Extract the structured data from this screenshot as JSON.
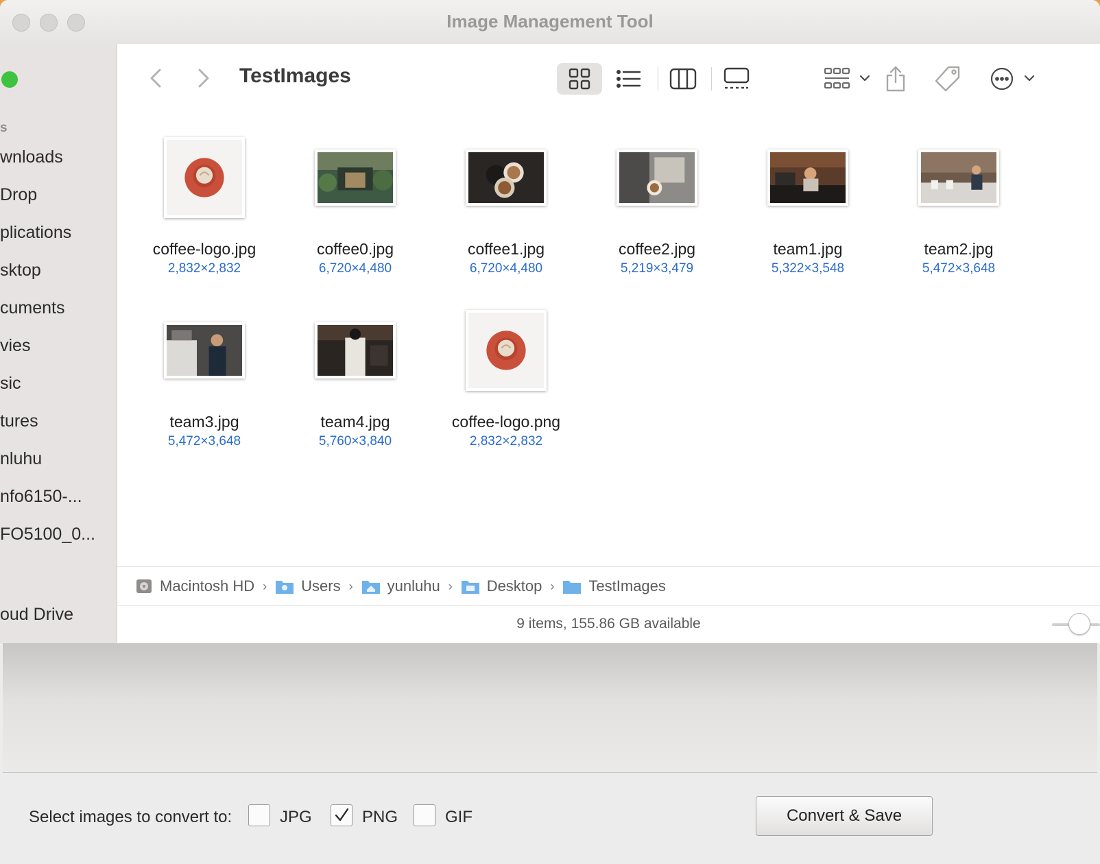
{
  "window": {
    "title": "Image Management Tool"
  },
  "sidebar": {
    "header": "s",
    "items": [
      "wnloads",
      "Drop",
      "plications",
      "sktop",
      "cuments",
      "vies",
      "sic",
      "tures",
      "nluhu",
      "nfo6150-...",
      "FO5100_0...",
      "oud Drive"
    ]
  },
  "toolbar": {
    "folder_title": "TestImages",
    "icons": [
      "back-icon",
      "forward-icon",
      "icon-view-icon",
      "list-view-icon",
      "column-view-icon",
      "gallery-view-icon",
      "group-icon",
      "share-icon",
      "tag-icon",
      "more-icon"
    ]
  },
  "files": [
    {
      "name": "coffee-logo.jpg",
      "dims": "2,832×2,832",
      "kind": "logo"
    },
    {
      "name": "coffee0.jpg",
      "dims": "6,720×4,480",
      "kind": "photo-green"
    },
    {
      "name": "coffee1.jpg",
      "dims": "6,720×4,480",
      "kind": "photo-dark"
    },
    {
      "name": "coffee2.jpg",
      "dims": "5,219×3,479",
      "kind": "photo-grey"
    },
    {
      "name": "team1.jpg",
      "dims": "5,322×3,548",
      "kind": "photo-warm"
    },
    {
      "name": "team2.jpg",
      "dims": "5,472×3,648",
      "kind": "photo-warm2"
    },
    {
      "name": "team3.jpg",
      "dims": "5,472×3,648",
      "kind": "photo-blue"
    },
    {
      "name": "team4.jpg",
      "dims": "5,760×3,840",
      "kind": "photo-dark2"
    },
    {
      "name": "coffee-logo.png",
      "dims": "2,832×2,832",
      "kind": "logo"
    }
  ],
  "path": [
    "Macintosh HD",
    "Users",
    "yunluhu",
    "Desktop",
    "TestImages"
  ],
  "status": "9 items, 155.86 GB available",
  "bottom": {
    "label": "Select images to convert to:",
    "options": [
      {
        "label": "JPG",
        "checked": false
      },
      {
        "label": "PNG",
        "checked": true
      },
      {
        "label": "GIF",
        "checked": false
      }
    ],
    "convert_button": "Convert & Save"
  },
  "colors": {
    "accent_link": "#2a6bd0",
    "traffic_green": "#3fc23f"
  }
}
